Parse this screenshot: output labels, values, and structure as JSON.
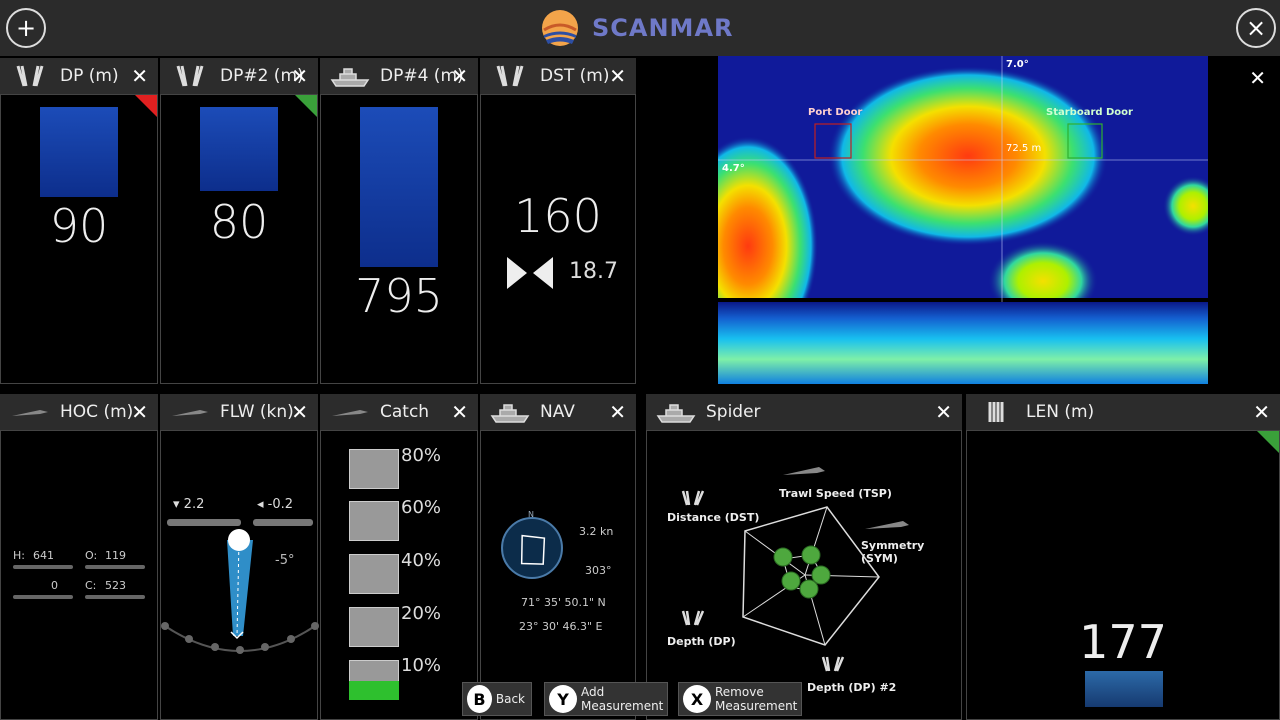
{
  "header": {
    "brand": "SCANMAR",
    "add_icon": "plus-icon",
    "close_icon": "close-icon"
  },
  "top_panels": [
    {
      "title": "DP (m)",
      "value": "90",
      "indicator": "#e02020"
    },
    {
      "title": "DP#2 (m)",
      "value": "80",
      "indicator": "#3aa03a"
    },
    {
      "title": "DP#4 (m)",
      "value": "795"
    },
    {
      "title": "DST (m)",
      "value": "160",
      "sub_value": "18.7"
    }
  ],
  "sonar": {
    "port_label": "Port Door",
    "starboard_label": "Starboard Door",
    "top_angle": "7.0°",
    "left_angle": "4.7°",
    "center_range": "72.5 m"
  },
  "bottom_panels": {
    "hoc": {
      "title": "HOC (m)",
      "h_label": "H:",
      "h_value": "641",
      "o_label": "O:",
      "o_value": "119",
      "left_value": "0",
      "c_label": "C:",
      "c_value": "523"
    },
    "flw": {
      "title": "FLW (kn)",
      "left_value": "2.2",
      "right_value": "-0.2",
      "angle": "-5°"
    },
    "catch": {
      "title": "Catch",
      "levels": [
        "80%",
        "60%",
        "40%",
        "20%",
        "10%"
      ],
      "filled_level": 0.1
    },
    "nav": {
      "title": "NAV",
      "north": "N",
      "speed": "3.2 kn",
      "heading": "303°",
      "lat": "71° 35' 50.1\" N",
      "lon": "23° 30' 46.3\" E"
    },
    "spider": {
      "title": "Spider",
      "labels": [
        "Trawl Speed (TSP)",
        "Distance (DST)",
        "Symmetry (SYM)",
        "Depth (DP)",
        "Depth (DP) #2"
      ]
    },
    "len": {
      "title": "LEN (m)",
      "value": "177"
    }
  },
  "actions": [
    {
      "key": "B",
      "label": "Back"
    },
    {
      "key": "Y",
      "label": "Add Measurement"
    },
    {
      "key": "X",
      "label": "Remove Measurement"
    }
  ]
}
